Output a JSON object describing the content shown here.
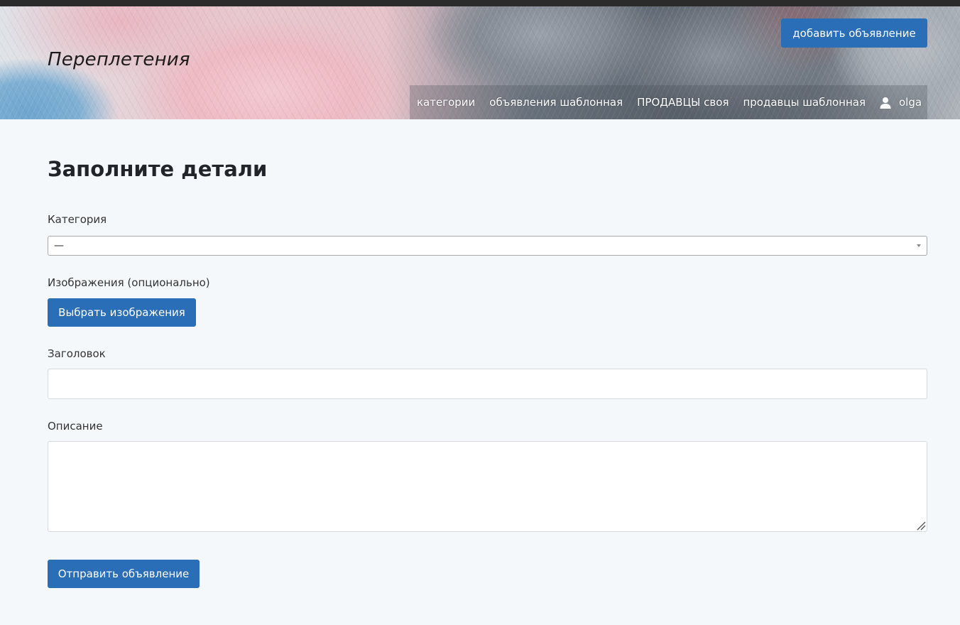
{
  "header": {
    "brand": "Переплетения",
    "add_button_label": "добавить объявление",
    "nav": [
      {
        "label": "категории"
      },
      {
        "label": "объявления шаблонная"
      },
      {
        "label": "ПРОДАВЦЫ своя"
      },
      {
        "label": "продавцы шаблонная"
      }
    ],
    "user": {
      "name": "olga",
      "icon": "user-icon"
    }
  },
  "form": {
    "title": "Заполните детали",
    "category": {
      "label": "Категория",
      "value": "—"
    },
    "images": {
      "label": "Изображения (опционально)",
      "button_label": "Выбрать изображения"
    },
    "heading": {
      "label": "Заголовок",
      "value": ""
    },
    "description": {
      "label": "Описание",
      "value": ""
    },
    "submit_label": "Отправить объявление"
  },
  "colors": {
    "accent": "#2a6eb8",
    "background": "#f5f8fb"
  }
}
